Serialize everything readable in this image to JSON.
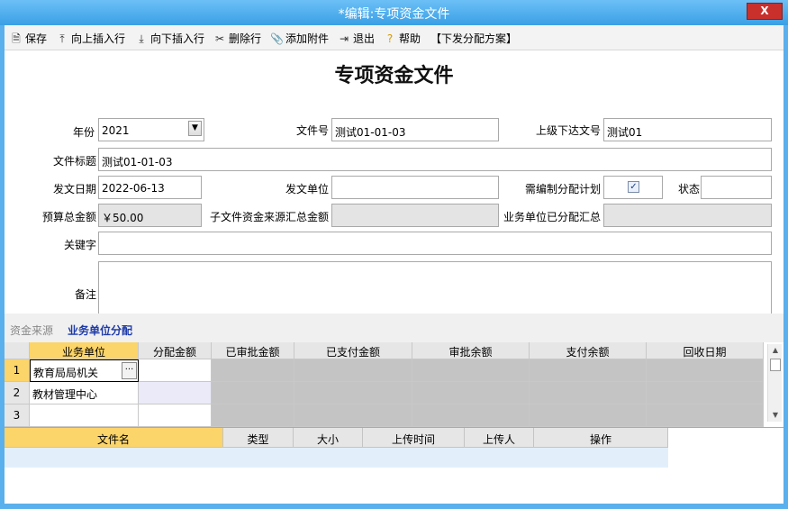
{
  "window": {
    "title": "*编辑:专项资金文件",
    "close_label": "X"
  },
  "toolbar": [
    {
      "icon": "save-icon",
      "glyph": "🗎",
      "label": "保存"
    },
    {
      "icon": "insert-above-icon",
      "glyph": "⤒",
      "label": "向上插入行"
    },
    {
      "icon": "insert-below-icon",
      "glyph": "⤓",
      "label": "向下插入行"
    },
    {
      "icon": "delete-row-icon",
      "glyph": "✂",
      "label": "删除行"
    },
    {
      "icon": "paperclip-icon",
      "glyph": "📎",
      "label": "添加附件"
    },
    {
      "icon": "exit-icon",
      "glyph": "⇥",
      "label": "退出"
    },
    {
      "icon": "help-icon",
      "glyph": "?",
      "label": "帮助"
    },
    {
      "icon": "",
      "glyph": "",
      "label": "【下发分配方案】"
    }
  ],
  "form": {
    "title": "专项资金文件",
    "year": {
      "label": "年份",
      "value": "2021"
    },
    "doc_no": {
      "label": "文件号",
      "value": "测试01-01-03"
    },
    "parent_doc_no": {
      "label": "上级下达文号",
      "value": "测试01"
    },
    "doc_title": {
      "label": "文件标题",
      "value": "测试01-01-03"
    },
    "issue_date": {
      "label": "发文日期",
      "value": "2022-06-13"
    },
    "issuer": {
      "label": "发文单位",
      "value": ""
    },
    "need_plan": {
      "label": "需编制分配计划",
      "checked": true
    },
    "status": {
      "label": "状态",
      "value": ""
    },
    "budget_total": {
      "label": "预算总金额",
      "value": "￥50.00"
    },
    "sub_total": {
      "label": "子文件资金来源汇总金额",
      "value": ""
    },
    "allocated_total": {
      "label": "业务单位已分配汇总",
      "value": ""
    },
    "keywords": {
      "label": "关键字",
      "value": ""
    },
    "remarks": {
      "label": "备注",
      "value": ""
    }
  },
  "tabs": [
    {
      "label": "资金来源",
      "active": false
    },
    {
      "label": "业务单位分配",
      "active": true
    }
  ],
  "grid": {
    "columns": [
      "业务单位",
      "分配金额",
      "已审批金额",
      "已支付金额",
      "审批余额",
      "支付余额",
      "回收日期"
    ],
    "rows": [
      {
        "num": "1",
        "unit": "教育局局机关"
      },
      {
        "num": "2",
        "unit": "教材管理中心"
      },
      {
        "num": "3",
        "unit": ""
      }
    ],
    "ellipsis_label": "···"
  },
  "attachments": {
    "columns": [
      "文件名",
      "类型",
      "大小",
      "上传时间",
      "上传人",
      "操作"
    ]
  }
}
